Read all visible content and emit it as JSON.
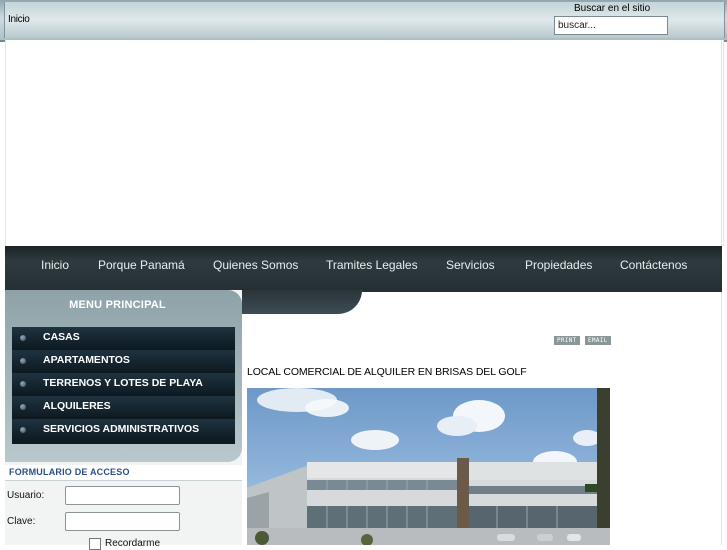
{
  "header": {
    "breadcrumb": "Inicio",
    "search_label": "Buscar en el sitio",
    "search_value": "buscar..."
  },
  "nav": {
    "items": [
      "Inicio",
      "Porque Panamá",
      "Quienes Somos",
      "Tramites Legales",
      "Servicios",
      "Propiedades",
      "Contáctenos"
    ]
  },
  "menu": {
    "title": "MENU PRINCIPAL",
    "items": [
      "CASAS",
      "APARTAMENTOS",
      "TERRENOS Y LOTES DE PLAYA",
      "ALQUILERES",
      "SERVICIOS ADMINISTRATIVOS"
    ]
  },
  "login": {
    "title": "FORMULARIO DE ACCESO",
    "user_label": "Usuario:",
    "pass_label": "Clave:",
    "remember_label": "Recordarme"
  },
  "article": {
    "print_label": "PRINT",
    "email_label": "EMAIL",
    "title": "LOCAL COMERCIAL DE ALQUILER EN BRISAS DEL GOLF"
  },
  "colors": {
    "nav_bg": "#263034",
    "menu_item_bg": "#1f3340",
    "login_title": "#2b4f86",
    "topbar": "#cfdde0"
  }
}
